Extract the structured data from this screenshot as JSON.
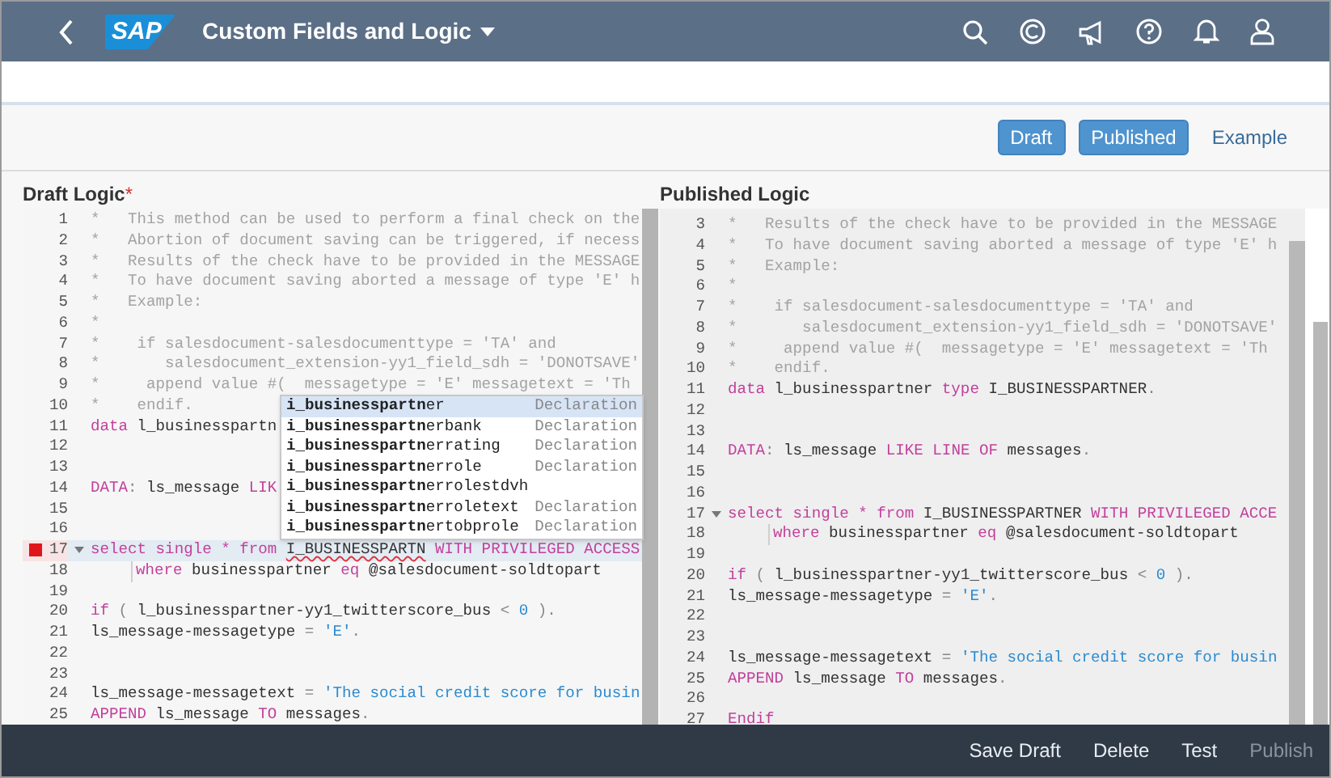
{
  "header": {
    "logo": "SAP",
    "title": "Custom Fields and Logic"
  },
  "view_buttons": [
    {
      "label": "Draft",
      "kind": "filled"
    },
    {
      "label": "Published",
      "kind": "filled"
    },
    {
      "label": "Example",
      "kind": "link"
    }
  ],
  "draft": {
    "title": "Draft Logic",
    "required_mark": "*",
    "lines": [
      {
        "number": "1",
        "tokens": [
          {
            "kind": "comment",
            "text": "*   This method can be used to perform a final check on the"
          }
        ]
      },
      {
        "number": "2",
        "tokens": [
          {
            "kind": "comment",
            "text": "*   Abortion of document saving can be triggered, if necess"
          }
        ]
      },
      {
        "number": "3",
        "tokens": [
          {
            "kind": "comment",
            "text": "*   Results of the check have to be provided in the MESSAGE"
          }
        ]
      },
      {
        "number": "4",
        "tokens": [
          {
            "kind": "comment",
            "text": "*   To have document saving aborted a message of type 'E' h"
          }
        ]
      },
      {
        "number": "5",
        "tokens": [
          {
            "kind": "comment",
            "text": "*   Example:"
          }
        ]
      },
      {
        "number": "6",
        "tokens": [
          {
            "kind": "comment",
            "text": "*"
          }
        ]
      },
      {
        "number": "7",
        "tokens": [
          {
            "kind": "comment",
            "text": "*    if salesdocument-salesdocumenttype = 'TA' and"
          }
        ]
      },
      {
        "number": "8",
        "tokens": [
          {
            "kind": "comment",
            "text": "*       salesdocument_extension-yy1_field_sdh = 'DONOTSAVE'"
          }
        ]
      },
      {
        "number": "9",
        "tokens": [
          {
            "kind": "comment",
            "text": "*     append value #(  messagetype = 'E' messagetext = 'Th"
          }
        ]
      },
      {
        "number": "10",
        "tokens": [
          {
            "kind": "comment",
            "text": "*    endif."
          }
        ]
      },
      {
        "number": "11",
        "tokens": [
          {
            "kind": "keyword",
            "text": "data"
          },
          {
            "kind": "plain",
            "text": " l_businesspartn"
          }
        ]
      },
      {
        "number": "12"
      },
      {
        "number": "13"
      },
      {
        "number": "14",
        "tokens": [
          {
            "kind": "keyword",
            "text": "DATA"
          },
          {
            "kind": "punct",
            "text": ":"
          },
          {
            "kind": "plain",
            "text": " ls_message "
          },
          {
            "kind": "keyword",
            "text": "LIK"
          }
        ]
      },
      {
        "number": "15"
      },
      {
        "number": "16"
      },
      {
        "number": "17",
        "breakpoint": true,
        "foldable": true,
        "active": true,
        "tokens": [
          {
            "kind": "keyword",
            "text": "select single * from "
          },
          {
            "kind": "error",
            "text": "I_BUSINESSPARTN"
          },
          {
            "kind": "keyword",
            "text": " WITH PRIVILEGED ACCESS"
          }
        ]
      },
      {
        "number": "18",
        "indent_guide": true,
        "tokens": [
          {
            "kind": "keyword",
            "text": "where"
          },
          {
            "kind": "plain",
            "text": " businesspartner "
          },
          {
            "kind": "keyword",
            "text": "eq"
          },
          {
            "kind": "plain",
            "text": " @salesdocument-soldtopart"
          }
        ]
      },
      {
        "number": "19"
      },
      {
        "number": "20",
        "tokens": [
          {
            "kind": "keyword",
            "text": "if"
          },
          {
            "kind": "punct",
            "text": " ( "
          },
          {
            "kind": "plain",
            "text": "l_businesspartner-yy1_twitterscore_bus"
          },
          {
            "kind": "punct",
            "text": " < "
          },
          {
            "kind": "number",
            "text": "0"
          },
          {
            "kind": "punct",
            "text": " )."
          }
        ]
      },
      {
        "number": "21",
        "tokens": [
          {
            "kind": "plain",
            "text": "ls_message-messagetype"
          },
          {
            "kind": "punct",
            "text": " = "
          },
          {
            "kind": "string",
            "text": "'E'"
          },
          {
            "kind": "punct",
            "text": "."
          }
        ]
      },
      {
        "number": "22"
      },
      {
        "number": "23"
      },
      {
        "number": "24",
        "tokens": [
          {
            "kind": "plain",
            "text": "ls_message-messagetext"
          },
          {
            "kind": "punct",
            "text": " = "
          },
          {
            "kind": "string",
            "text": "'The social credit score for busin"
          }
        ]
      },
      {
        "number": "25",
        "tokens": [
          {
            "kind": "keyword",
            "text": "APPEND"
          },
          {
            "kind": "plain",
            "text": " ls_message "
          },
          {
            "kind": "keyword",
            "text": "TO"
          },
          {
            "kind": "plain",
            "text": " messages"
          },
          {
            "kind": "punct",
            "text": "."
          }
        ]
      }
    ],
    "autocomplete": [
      {
        "name": "**i_businesspartn**er",
        "type": "Declaration",
        "selected": true
      },
      {
        "name": "**i_businesspartn**erbank",
        "type": "Declaration",
        "selected": false
      },
      {
        "name": "**i_businesspartn**errating",
        "type": "Declaration",
        "selected": false
      },
      {
        "name": "**i_businesspartn**errole",
        "type": "Declaration",
        "selected": false
      },
      {
        "name": "**i_businesspartn**errolestdvh",
        "selected": false
      },
      {
        "name": "**i_businesspartn**erroletext",
        "type": "Declaration",
        "selected": false
      },
      {
        "name": "**i_businesspartn**ertobprole",
        "type": "Declaration",
        "selected": false
      }
    ]
  },
  "published": {
    "title": "Published Logic",
    "lines": [
      {
        "number": "3",
        "tokens": [
          {
            "kind": "comment",
            "text": "*   Results of the check have to be provided in the MESSAGE"
          }
        ]
      },
      {
        "number": "4",
        "tokens": [
          {
            "kind": "comment",
            "text": "*   To have document saving aborted a message of type 'E' h"
          }
        ]
      },
      {
        "number": "5",
        "tokens": [
          {
            "kind": "comment",
            "text": "*   Example:"
          }
        ]
      },
      {
        "number": "6",
        "tokens": [
          {
            "kind": "comment",
            "text": "*"
          }
        ]
      },
      {
        "number": "7",
        "tokens": [
          {
            "kind": "comment",
            "text": "*    if salesdocument-salesdocumenttype = 'TA' and"
          }
        ]
      },
      {
        "number": "8",
        "tokens": [
          {
            "kind": "comment",
            "text": "*       salesdocument_extension-yy1_field_sdh = 'DONOTSAVE'"
          }
        ]
      },
      {
        "number": "9",
        "tokens": [
          {
            "kind": "comment",
            "text": "*     append value #(  messagetype = 'E' messagetext = 'Th"
          }
        ]
      },
      {
        "number": "10",
        "tokens": [
          {
            "kind": "comment",
            "text": "*    endif."
          }
        ]
      },
      {
        "number": "11",
        "tokens": [
          {
            "kind": "keyword",
            "text": "data"
          },
          {
            "kind": "plain",
            "text": " l_businesspartner "
          },
          {
            "kind": "keyword",
            "text": "type"
          },
          {
            "kind": "plain",
            "text": " I_BUSINESSPARTNER"
          },
          {
            "kind": "punct",
            "text": "."
          }
        ]
      },
      {
        "number": "12"
      },
      {
        "number": "13"
      },
      {
        "number": "14",
        "tokens": [
          {
            "kind": "keyword",
            "text": "DATA"
          },
          {
            "kind": "punct",
            "text": ":"
          },
          {
            "kind": "plain",
            "text": " ls_message "
          },
          {
            "kind": "keyword",
            "text": "LIKE LINE OF"
          },
          {
            "kind": "plain",
            "text": " messages"
          },
          {
            "kind": "punct",
            "text": "."
          }
        ]
      },
      {
        "number": "15"
      },
      {
        "number": "16"
      },
      {
        "number": "17",
        "foldable": true,
        "tokens": [
          {
            "kind": "keyword",
            "text": "select single * from"
          },
          {
            "kind": "plain",
            "text": " I_BUSINESSPARTNER "
          },
          {
            "kind": "keyword",
            "text": "WITH PRIVILEGED ACCE"
          }
        ]
      },
      {
        "number": "18",
        "indent_guide": true,
        "tokens": [
          {
            "kind": "keyword",
            "text": "where"
          },
          {
            "kind": "plain",
            "text": " businesspartner "
          },
          {
            "kind": "keyword",
            "text": "eq"
          },
          {
            "kind": "plain",
            "text": " @salesdocument-soldtopart"
          }
        ]
      },
      {
        "number": "19"
      },
      {
        "number": "20",
        "tokens": [
          {
            "kind": "keyword",
            "text": "if"
          },
          {
            "kind": "punct",
            "text": " ( "
          },
          {
            "kind": "plain",
            "text": "l_businesspartner-yy1_twitterscore_bus"
          },
          {
            "kind": "punct",
            "text": " < "
          },
          {
            "kind": "number",
            "text": "0"
          },
          {
            "kind": "punct",
            "text": " )."
          }
        ]
      },
      {
        "number": "21",
        "tokens": [
          {
            "kind": "plain",
            "text": "ls_message-messagetype"
          },
          {
            "kind": "punct",
            "text": " = "
          },
          {
            "kind": "string",
            "text": "'E'"
          },
          {
            "kind": "punct",
            "text": "."
          }
        ]
      },
      {
        "number": "22"
      },
      {
        "number": "23"
      },
      {
        "number": "24",
        "tokens": [
          {
            "kind": "plain",
            "text": "ls_message-messagetext"
          },
          {
            "kind": "punct",
            "text": " = "
          },
          {
            "kind": "string",
            "text": "'The social credit score for busin"
          }
        ]
      },
      {
        "number": "25",
        "tokens": [
          {
            "kind": "keyword",
            "text": "APPEND"
          },
          {
            "kind": "plain",
            "text": " ls_message "
          },
          {
            "kind": "keyword",
            "text": "TO"
          },
          {
            "kind": "plain",
            "text": " messages"
          },
          {
            "kind": "punct",
            "text": "."
          }
        ]
      },
      {
        "number": "26"
      },
      {
        "number": "27",
        "tokens": [
          {
            "kind": "keyword",
            "text": "Endif"
          }
        ]
      }
    ]
  },
  "footer_buttons": [
    {
      "label": "Save Draft",
      "disabled": false
    },
    {
      "label": "Delete",
      "disabled": false
    },
    {
      "label": "Test",
      "disabled": false
    },
    {
      "label": "Publish",
      "disabled": true
    }
  ]
}
